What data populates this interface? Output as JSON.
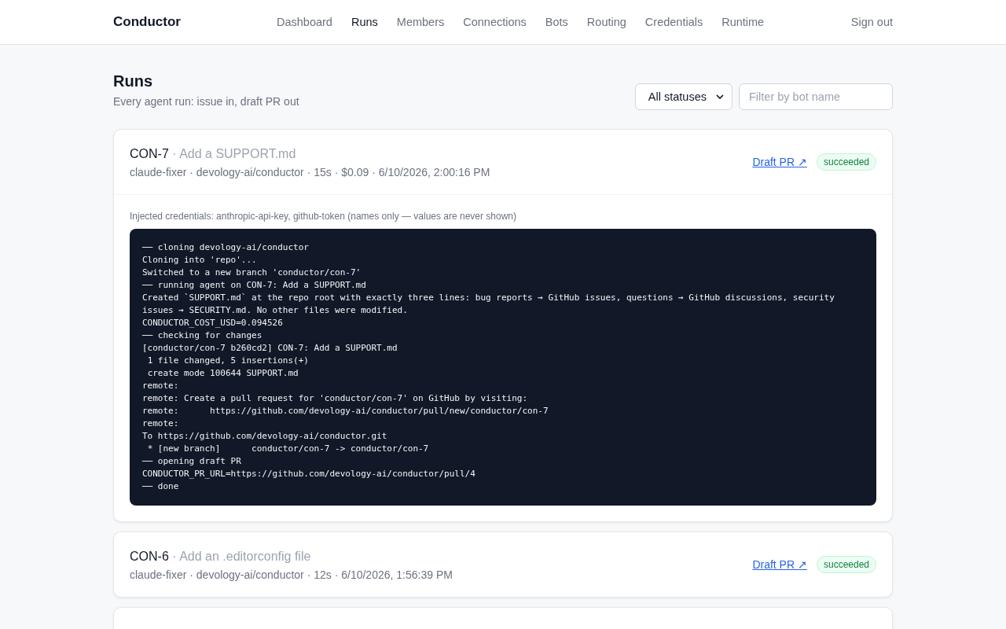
{
  "brand": "Conductor",
  "nav": [
    {
      "label": "Dashboard",
      "selected": false
    },
    {
      "label": "Runs",
      "selected": true
    },
    {
      "label": "Members",
      "selected": false
    },
    {
      "label": "Connections",
      "selected": false
    },
    {
      "label": "Bots",
      "selected": false
    },
    {
      "label": "Routing",
      "selected": false
    },
    {
      "label": "Credentials",
      "selected": false
    },
    {
      "label": "Runtime",
      "selected": false
    }
  ],
  "sign_out": "Sign out",
  "page": {
    "title": "Runs",
    "subtitle": "Every agent run: issue in, draft PR out"
  },
  "filters": {
    "status": "All statuses",
    "bot": {
      "placeholder": "Filter by bot name"
    }
  },
  "runs": [
    {
      "id": "CON-7",
      "title": "· Add a SUPPORT.md",
      "meta": "claude-fixer · devology-ai/conductor · 15s · $0.09 · 6/10/2026, 2:00:16 PM",
      "link": "Draft PR ↗",
      "status": "succeeded",
      "expanded": true,
      "credentials": "Injected credentials: anthropic-api-key, github-token (names only — values are never shown)",
      "log": [
        "── cloning devology-ai/conductor",
        "Cloning into 'repo'...",
        "Switched to a new branch 'conductor/con-7'",
        "── running agent on CON-7: Add a SUPPORT.md",
        "Created `SUPPORT.md` at the repo root with exactly three lines: bug reports → GitHub issues, questions → GitHub discussions, security issues → SECURITY.md. No other files were modified.",
        "CONDUCTOR_COST_USD=0.094526",
        "── checking for changes",
        "[conductor/con-7 b260cd2] CON-7: Add a SUPPORT.md",
        " 1 file changed, 5 insertions(+)",
        " create mode 100644 SUPPORT.md",
        "remote:",
        "remote: Create a pull request for 'conductor/con-7' on GitHub by visiting:",
        "remote:      https://github.com/devology-ai/conductor/pull/new/conductor/con-7",
        "remote:",
        "To https://github.com/devology-ai/conductor.git",
        " * [new branch]      conductor/con-7 -> conductor/con-7",
        "── opening draft PR",
        "CONDUCTOR_PR_URL=https://github.com/devology-ai/conductor/pull/4",
        "── done"
      ]
    },
    {
      "id": "CON-6",
      "title": "· Add an .editorconfig file",
      "meta": "claude-fixer · devology-ai/conductor · 12s · 6/10/2026, 1:56:39 PM",
      "link": "Draft PR ↗",
      "status": "succeeded",
      "expanded": false
    }
  ]
}
